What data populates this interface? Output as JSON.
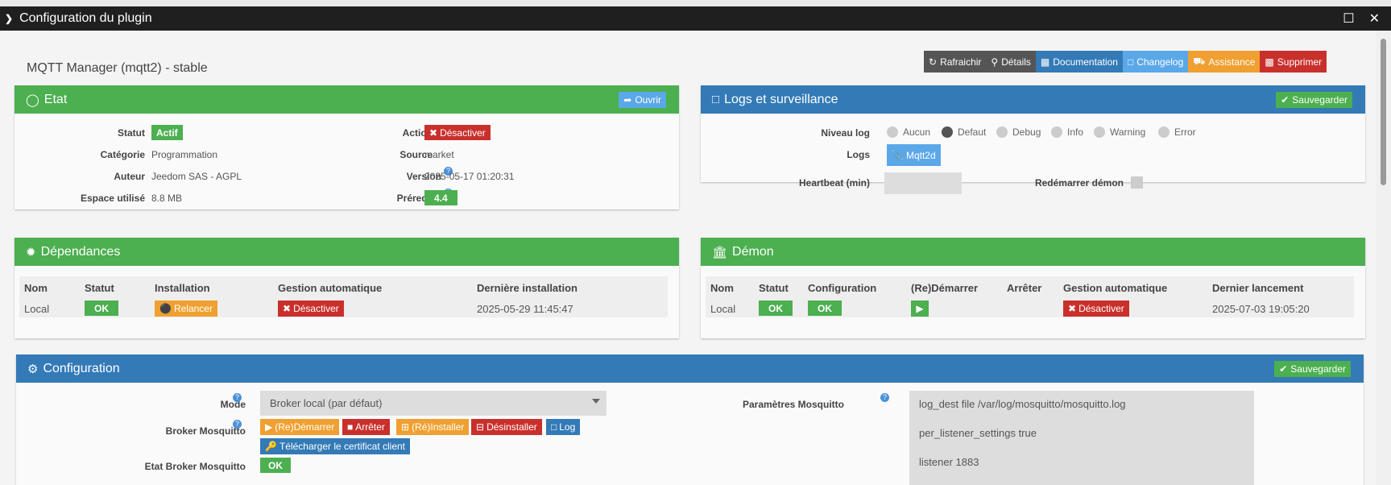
{
  "window": {
    "title": "Configuration du plugin"
  },
  "page": {
    "heading": "MQTT Manager (mqtt2) - stable"
  },
  "toolbar": {
    "refresh": "Rafraichir",
    "details": "Détails",
    "documentation": "Documentation",
    "changelog": "Changelog",
    "assistance": "Assistance",
    "delete": "Supprimer"
  },
  "etat": {
    "title": "Etat",
    "open": "Ouvrir",
    "statut_label": "Statut",
    "statut_value": "Actif",
    "categorie_label": "Catégorie",
    "categorie_value": "Programmation",
    "auteur_label": "Auteur",
    "auteur_value": "Jeedom SAS - AGPL",
    "espace_label": "Espace utilisé",
    "espace_value": "8.8 MB",
    "action_label": "Action",
    "action_value": "Désactiver",
    "source_label": "Source",
    "source_value": "market",
    "version_label": "Version",
    "version_value": "2025-05-17 01:20:31",
    "prerequis_label": "Prérequis",
    "prerequis_value": "4.4"
  },
  "logs": {
    "title": "Logs et surveillance",
    "save": "Sauvegarder",
    "niveau_label": "Niveau log",
    "levels": [
      "Aucun",
      "Defaut",
      "Debug",
      "Info",
      "Warning",
      "Error"
    ],
    "logs_label": "Logs",
    "log_button": "Mqtt2d",
    "heartbeat_label": "Heartbeat (min)",
    "restart_label": "Redémarrer démon"
  },
  "dependances": {
    "title": "Dépendances",
    "headers": [
      "Nom",
      "Statut",
      "Installation",
      "Gestion automatique",
      "Dernière installation"
    ],
    "row": {
      "nom": "Local",
      "statut": "OK",
      "installation": "Relancer",
      "gestion": "Désactiver",
      "derniere": "2025-05-29 11:45:47"
    }
  },
  "demon": {
    "title": "Démon",
    "headers": [
      "Nom",
      "Statut",
      "Configuration",
      "(Re)Démarrer",
      "Arrêter",
      "Gestion automatique",
      "Dernier lancement"
    ],
    "row": {
      "nom": "Local",
      "statut": "OK",
      "configuration": "OK",
      "gestion": "Désactiver",
      "dernier": "2025-07-03 19:05:20"
    }
  },
  "configuration": {
    "title": "Configuration",
    "save": "Sauvegarder",
    "mode_label": "Mode",
    "mode_value": "Broker local (par défaut)",
    "broker_label": "Broker Mosquitto",
    "broker_buttons": {
      "start": "(Re)Démarrer",
      "stop": "Arrêter",
      "install": "(Ré)Installer",
      "uninstall": "Désinstaller",
      "log": "Log"
    },
    "certificate": "Télécharger le certificat client",
    "etat_broker_label": "Etat Broker Mosquitto",
    "etat_broker_value": "OK",
    "params_label": "Paramètres Mosquitto",
    "params_value": "log_dest file /var/log/mosquitto/mosquitto.log\n\nper_listener_settings true\n\nlistener 1883"
  },
  "colors": {
    "green": "#4caf50",
    "blue": "#337ab7",
    "red": "#c9302c",
    "orange": "#f0a030",
    "lightblue": "#5ba8e8",
    "dark": "#555555"
  }
}
